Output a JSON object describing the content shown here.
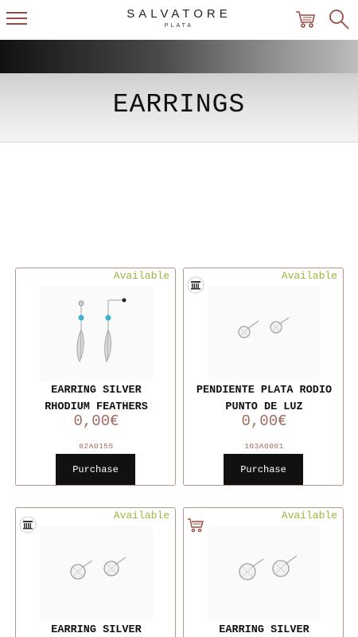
{
  "header": {
    "brand": "SALVATORE",
    "brand_sub": "PLATA",
    "menu_icon": "hamburger-icon",
    "cart_icon": "cart-icon",
    "search_icon": "search-icon",
    "accent_color": "#9a4a44"
  },
  "hero": {
    "title": "EARRINGS"
  },
  "products": [
    {
      "availability": "Available",
      "icon": "",
      "name_line1": "EARRING SILVER",
      "name_line2": "RHODIUM FEATHERS",
      "price": "0,00€",
      "ref": "02A0155",
      "button": "Purchase"
    },
    {
      "availability": "Available",
      "icon": "store-icon",
      "name_line1": "PENDIENTE PLATA RODIO",
      "name_line2": "PUNTO DE LUZ",
      "price": "0,00€",
      "ref": "103A0001",
      "button": "Purchase"
    },
    {
      "availability": "Available",
      "icon": "store-icon",
      "name_line1": "EARRING SILVER",
      "name_line2": ""
    },
    {
      "availability": "Available",
      "icon": "shopping-cart-icon",
      "name_line1": "EARRING SILVER",
      "name_line2": ""
    }
  ],
  "colors": {
    "available": "#9ab63a",
    "price": "#a56a62",
    "card_border": "#b9938d"
  }
}
